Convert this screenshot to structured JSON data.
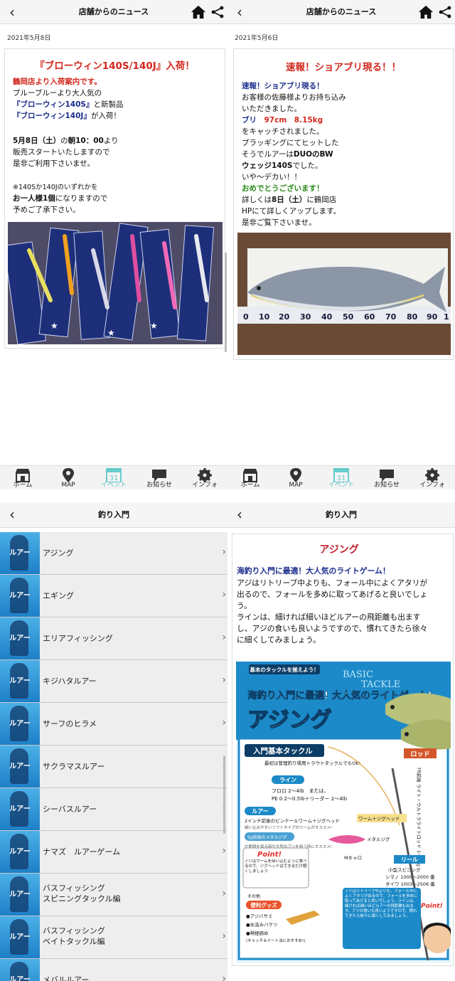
{
  "tl": {
    "header": {
      "title": "店舗からのニュース"
    },
    "date": "2021年5月8日",
    "card": {
      "heading": "『ブローウィン140S/140J』入荷！",
      "lines": [
        {
          "t": "鶴岡店より入荷案内です。",
          "c": "red"
        },
        {
          "t": "ブルーブルーより大人気の",
          "c": ""
        },
        {
          "t": "『ブローウィン140S』",
          "c": "blue",
          "tail": "と新製品"
        },
        {
          "t": "『ブローウィン140J』",
          "c": "blue",
          "tail": "が入荷！"
        },
        {
          "t": "",
          "c": ""
        },
        {
          "t": "5月8日（土）",
          "c": "blue",
          "tail": "の",
          "tail2": "朝10：00",
          "tail3": "より"
        },
        {
          "t": "販売スタートいたしますので",
          "c": ""
        },
        {
          "t": "是非ご利用下さいませ。",
          "c": ""
        },
        {
          "t": "",
          "c": ""
        },
        {
          "t": "※140Sか140Jのいずれかを",
          "c": ""
        },
        {
          "t": "お一人様1個",
          "c": "b",
          "tail": "になりますので"
        },
        {
          "t": "予めご了承下さい。",
          "c": ""
        }
      ],
      "photo_alt": "ルアー陳列写真"
    }
  },
  "tr": {
    "header": {
      "title": "店舗からのニュース"
    },
    "date": "2021年5月6日",
    "card": {
      "heading": "速報！ショアブリ現る！！",
      "lines": [
        {
          "t": "速報！ショアブリ現る！",
          "c": "blue"
        },
        {
          "t": "お客様の佐藤様よりお持ち込み",
          "c": ""
        },
        {
          "t": "いただきました。",
          "c": ""
        },
        {
          "t": "ブリ",
          "c": "blue",
          "tail": "　97cm　8.15kg",
          "tailc": "red"
        },
        {
          "t": "をキャッチされました。",
          "c": ""
        },
        {
          "t": "ブラッギングにてヒットした",
          "c": ""
        },
        {
          "t": "そうでルアーは",
          "c": "",
          "tail": "DUOのBW",
          "tailc": "b"
        },
        {
          "t": "ウェッジ140S",
          "c": "b",
          "tail": "でした。"
        },
        {
          "t": "いや〜デカい！！",
          "c": ""
        },
        {
          "t": "おめでとうございます！",
          "c": "green"
        },
        {
          "t": "詳しくは",
          "c": "",
          "tail": "8日（土）",
          "tailc": "b",
          "tail2": "に鶴岡店"
        },
        {
          "t": "HPにて詳しくアップします。",
          "c": ""
        },
        {
          "t": "是非ご覧下さいませ。",
          "c": ""
        }
      ],
      "ruler": [
        "0",
        "10",
        "20",
        "30",
        "40",
        "50",
        "60",
        "70",
        "80",
        "90",
        "1"
      ]
    }
  },
  "tabs": [
    {
      "label": "ホーム",
      "icon": "shop-icon"
    },
    {
      "label": "MAP",
      "icon": "pin-icon"
    },
    {
      "label": "イベント",
      "icon": "calendar-icon",
      "day": "31"
    },
    {
      "label": "お知らせ",
      "icon": "chat-icon"
    },
    {
      "label": "インフォ",
      "icon": "gear-icon"
    }
  ],
  "bl": {
    "header": {
      "title": "釣り入門"
    },
    "thumb_label": "ルアー",
    "items": [
      [
        "アジング"
      ],
      [
        "エギング"
      ],
      [
        "エリアフィッシング"
      ],
      [
        "キジハタルアー"
      ],
      [
        "サーフのヒラメ"
      ],
      [
        "サクラマスルアー"
      ],
      [
        "シーバスルアー"
      ],
      [
        "ナマズ　ルアーゲーム"
      ],
      [
        "バスフィッシング",
        "スピニングタックル編"
      ],
      [
        "バスフィッシング",
        "ベイトタックル編"
      ],
      [
        "メバルルアー"
      ]
    ]
  },
  "br": {
    "header": {
      "title": "釣り入門"
    },
    "title": "アジング",
    "lines": [
      {
        "t": "海釣り入門に最適！大人気のライトゲーム！",
        "c": "blue"
      },
      {
        "t": "アジはリトリーブ中よりも、フォール中によくアタリが",
        "c": ""
      },
      {
        "t": "出るので、フォールを多めに取ってあげると良いでしょ",
        "c": ""
      },
      {
        "t": "う。",
        "c": ""
      },
      {
        "t": "ラインは、細ければ細いほどルアーの飛距離も出ます",
        "c": ""
      },
      {
        "t": "し、アジの食いも良いようですので、慣れてきたら徐々",
        "c": ""
      },
      {
        "t": "に細くしてみましょう。",
        "c": ""
      }
    ],
    "poster": {
      "tag": "基本のタックルを揃えよう！",
      "basic": "BASIC",
      "tackle": "TACKLE",
      "sub": "海釣り入門に最適! 大人気のライトゲーム!",
      "big": "アジング",
      "sec": "入門基本タックル",
      "note": "最初は管理釣り場用トラウトタックルでもOK!",
      "rod": "ロッド",
      "rodtxt": "7ft前後 ライト・ウルトラライトロッド 1〜10g",
      "line": "ライン",
      "linetxt1": "フロロ 2〜4lb　または、",
      "linetxt2": "PE 0.2〜0.5lb＋リーダー 2〜4lb",
      "lure": "ルアー",
      "luretxt": "2インチ前後のピンテールワーム＋ジグヘッド",
      "luretxt2": "細い込みやすいリフトタイプのワームがオススメ!",
      "jig": "ワーム＋ジグヘッド",
      "metal": "メタルジグ",
      "metaltxt": "5g前後のメタルジグ",
      "metaltxt2": "広範囲を探る時や大型のアジを狙う時にオススメ!",
      "mcaro": "Mキャロ",
      "reel": "リール",
      "reeltxt": "小型スピニング",
      "reeltxt2": "シマノ 1000〜2000 番",
      "reeltxt3": "ダイワ 1003〜2506 番",
      "point": "Point!",
      "pointtxt": "アジはワームを吸い込むように食べるので、ジグヘッドはできるだけ軽くしましょう",
      "goods": "便利グッズ",
      "g1": "●アジバサミ",
      "g2": "●水汲みバケツ",
      "g3": "●神経締め",
      "g4": "(キャッチ＆イート派におすすめ!)",
      "sono": "その他",
      "bubble": "アジはリトリーブ中よりも、フォール中によくアタリが出るので、フォールを多めに取ってあげると良いでしょう。ラインは、細ければ細いほどルアーの飛距離も出ます。アジの食いも良いようですので、慣れてきたら徐々に細くしてみましょう。",
      "point2": "Point!"
    }
  }
}
